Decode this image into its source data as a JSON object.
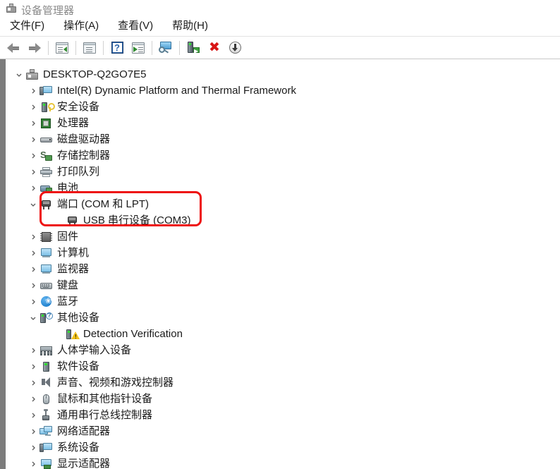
{
  "window": {
    "title": "设备管理器",
    "title_icon": "device-manager-icon"
  },
  "menu": {
    "items": [
      {
        "label": "文件(F)",
        "name": "menu-file"
      },
      {
        "label": "操作(A)",
        "name": "menu-action"
      },
      {
        "label": "查看(V)",
        "name": "menu-view"
      },
      {
        "label": "帮助(H)",
        "name": "menu-help"
      }
    ]
  },
  "toolbar": {
    "buttons": [
      {
        "icon": "back-arrow-icon",
        "name": "toolbar-back"
      },
      {
        "icon": "forward-arrow-icon",
        "name": "toolbar-forward"
      },
      {
        "icon": "properties-icon",
        "name": "toolbar-properties"
      },
      {
        "icon": "show-hidden-devices-icon",
        "name": "toolbar-show-hidden"
      },
      {
        "icon": "help-icon",
        "name": "toolbar-help"
      },
      {
        "icon": "update-driver-icon",
        "name": "toolbar-update-driver"
      },
      {
        "icon": "scan-hardware-changes-icon",
        "name": "toolbar-scan-changes"
      },
      {
        "icon": "enable-device-icon",
        "name": "toolbar-enable-device"
      },
      {
        "icon": "uninstall-device-icon",
        "name": "toolbar-uninstall-device"
      },
      {
        "icon": "disable-device-icon",
        "name": "toolbar-disable-device"
      }
    ]
  },
  "tree": {
    "root": {
      "label": "DESKTOP-Q2GO7E5",
      "icon": "computer-icon",
      "expanded": true
    },
    "nodes": [
      {
        "label": "Intel(R) Dynamic Platform and Thermal Framework",
        "icon": "system-device-icon",
        "depth": 1,
        "state": "collapsed"
      },
      {
        "label": "安全设备",
        "icon": "security-device-icon",
        "depth": 1,
        "state": "collapsed"
      },
      {
        "label": "处理器",
        "icon": "processor-icon",
        "depth": 1,
        "state": "collapsed"
      },
      {
        "label": "磁盘驱动器",
        "icon": "disk-drive-icon",
        "depth": 1,
        "state": "collapsed"
      },
      {
        "label": "存储控制器",
        "icon": "storage-controller-icon",
        "depth": 1,
        "state": "collapsed"
      },
      {
        "label": "打印队列",
        "icon": "print-queue-icon",
        "depth": 1,
        "state": "collapsed"
      },
      {
        "label": "电池",
        "icon": "battery-icon",
        "depth": 1,
        "state": "collapsed"
      },
      {
        "label": "端口 (COM 和 LPT)",
        "icon": "port-icon",
        "depth": 1,
        "state": "expanded",
        "highlighted": true
      },
      {
        "label": "USB 串行设备 (COM3)",
        "icon": "port-icon",
        "depth": 2,
        "state": "leaf",
        "highlighted": true
      },
      {
        "label": "固件",
        "icon": "firmware-icon",
        "depth": 1,
        "state": "collapsed"
      },
      {
        "label": "计算机",
        "icon": "computer-node-icon",
        "depth": 1,
        "state": "collapsed"
      },
      {
        "label": "监视器",
        "icon": "monitor-icon",
        "depth": 1,
        "state": "collapsed"
      },
      {
        "label": "键盘",
        "icon": "keyboard-icon",
        "depth": 1,
        "state": "collapsed"
      },
      {
        "label": "蓝牙",
        "icon": "bluetooth-icon",
        "depth": 1,
        "state": "collapsed"
      },
      {
        "label": "其他设备",
        "icon": "other-device-icon",
        "depth": 1,
        "state": "expanded"
      },
      {
        "label": "Detection Verification",
        "icon": "unknown-device-warning-icon",
        "depth": 2,
        "state": "leaf"
      },
      {
        "label": "人体学输入设备",
        "icon": "hid-icon",
        "depth": 1,
        "state": "collapsed"
      },
      {
        "label": "软件设备",
        "icon": "software-device-icon",
        "depth": 1,
        "state": "collapsed"
      },
      {
        "label": "声音、视频和游戏控制器",
        "icon": "sound-video-game-icon",
        "depth": 1,
        "state": "collapsed"
      },
      {
        "label": "鼠标和其他指针设备",
        "icon": "mouse-icon",
        "depth": 1,
        "state": "collapsed"
      },
      {
        "label": "通用串行总线控制器",
        "icon": "usb-controller-icon",
        "depth": 1,
        "state": "collapsed"
      },
      {
        "label": "网络适配器",
        "icon": "network-adapter-icon",
        "depth": 1,
        "state": "collapsed"
      },
      {
        "label": "系统设备",
        "icon": "system-devices-icon",
        "depth": 1,
        "state": "collapsed"
      },
      {
        "label": "显示适配器",
        "icon": "display-adapter-icon",
        "depth": 1,
        "state": "collapsed"
      }
    ]
  },
  "annotation": {
    "highlight_color": "#ee1111",
    "highlight_target": "端口 (COM 和 LPT)"
  }
}
